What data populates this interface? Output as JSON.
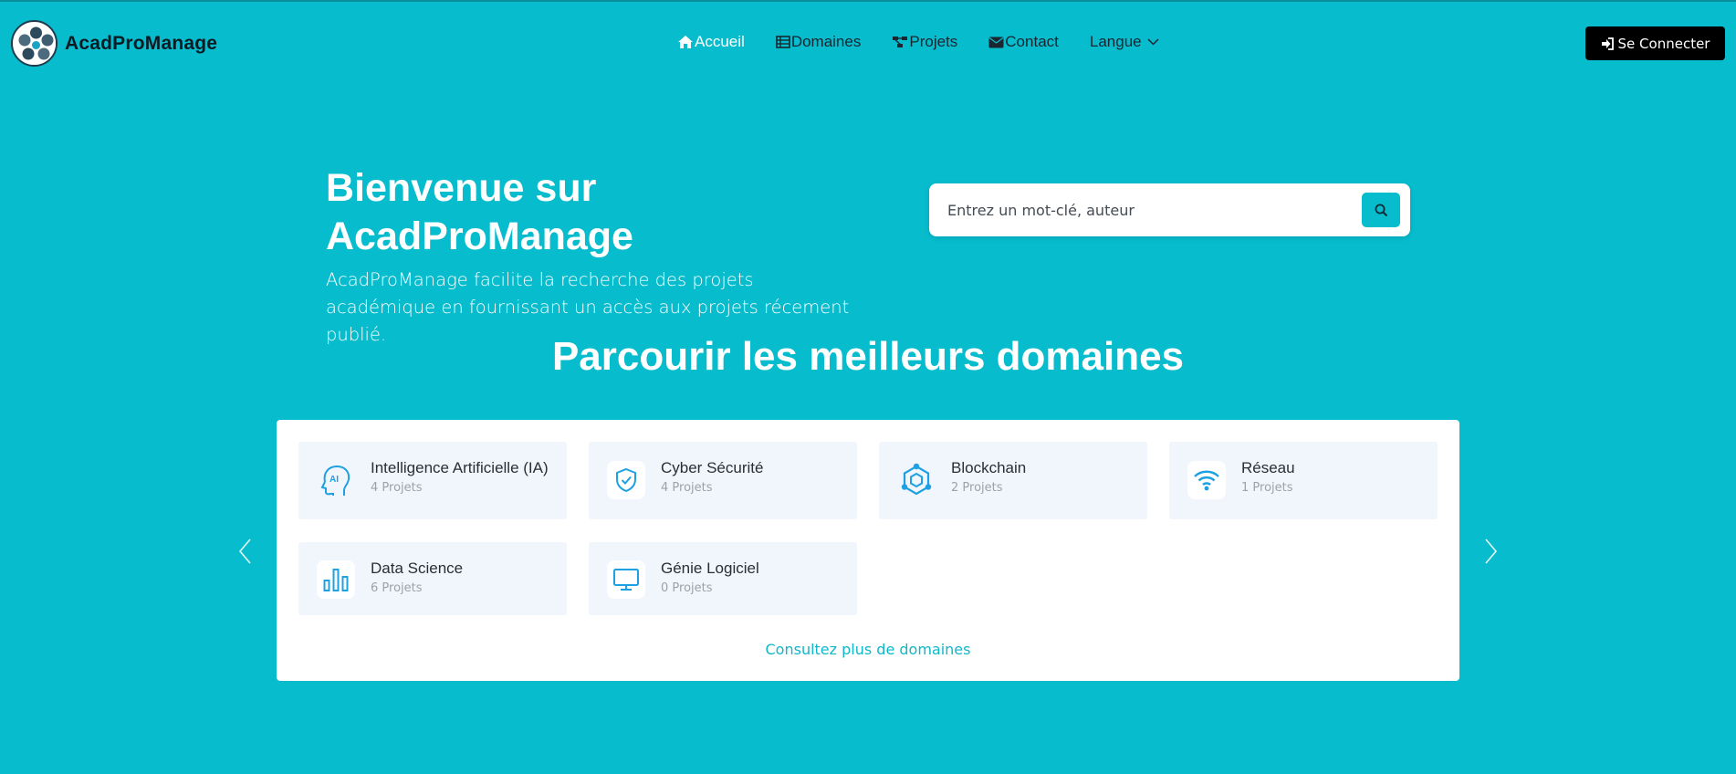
{
  "brand": {
    "name": "AcadProManage"
  },
  "nav": {
    "items": [
      {
        "label": "Accueil",
        "icon": "home-icon"
      },
      {
        "label": "Domaines",
        "icon": "table-list-icon"
      },
      {
        "label": "Projets",
        "icon": "diagram-icon"
      },
      {
        "label": "Contact",
        "icon": "envelope-icon"
      }
    ],
    "language_label": "Langue",
    "login_label": "Se Connecter"
  },
  "hero": {
    "title_line1": "Bienvenue sur",
    "title_line2": "AcadProManage",
    "description": "AcadProManage facilite la recherche des projets académique en fournissant un accès aux projets récement publié."
  },
  "search": {
    "placeholder": "Entrez un mot-clé, auteur"
  },
  "domains_section": {
    "title": "Parcourir les meilleurs domaines",
    "items": [
      {
        "name": "Intelligence Artificielle (IA)",
        "count": "4 Projets",
        "icon": "ai-head-icon"
      },
      {
        "name": "Cyber Sécurité",
        "count": "4 Projets",
        "icon": "shield-check-icon"
      },
      {
        "name": "Blockchain",
        "count": "2 Projets",
        "icon": "blockchain-icon"
      },
      {
        "name": "Réseau",
        "count": "1 Projets",
        "icon": "wifi-icon"
      },
      {
        "name": "Data Science",
        "count": "6 Projets",
        "icon": "bar-chart-icon"
      },
      {
        "name": "Génie Logiciel",
        "count": "0 Projets",
        "icon": "monitor-icon"
      }
    ],
    "more_label": "Consultez plus de domaines"
  },
  "colors": {
    "primary": "#06bccd",
    "icon_blue": "#1da1e2",
    "card_bg": "#f1f5fc",
    "button_dark": "#000000"
  }
}
